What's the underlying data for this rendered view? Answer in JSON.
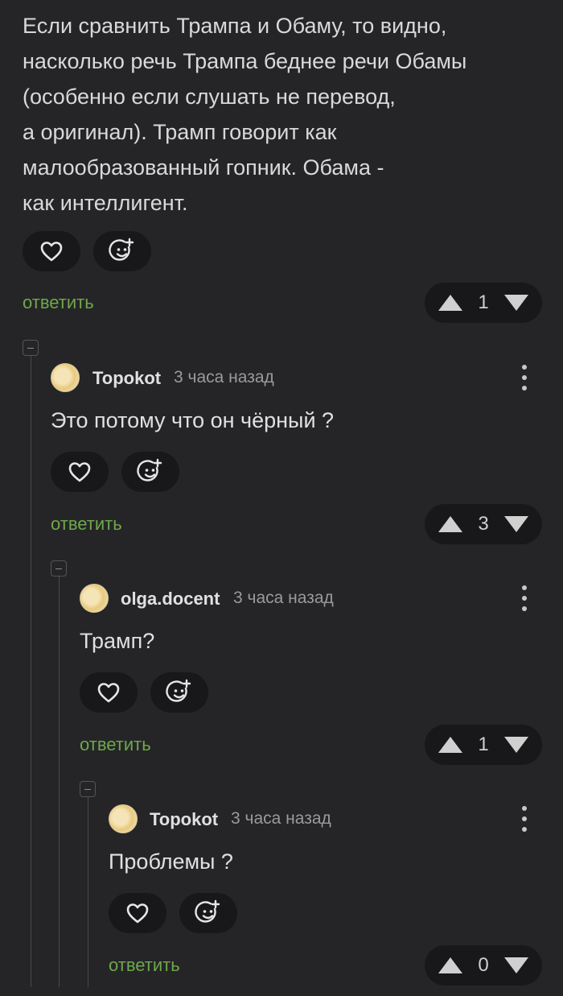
{
  "root": {
    "text": "Если сравнить Трампа и Обаму, то видно,\nнасколько речь Трампа беднее речи Обамы\n(особенно если слушать не перевод,\nа оригинал). Трамп говорит как\nмалообразованный гопник. Обама -\nкак интеллигент.",
    "reply_label": "ответить",
    "votes": "1"
  },
  "comments": [
    {
      "author": "Topokot",
      "time": "3 часа назад",
      "text": "Это потому что он чёрный ?",
      "reply_label": "ответить",
      "votes": "3"
    },
    {
      "author": "olga.docent",
      "time": "3 часа назад",
      "text": "Трамп?",
      "reply_label": "ответить",
      "votes": "1"
    },
    {
      "author": "Topokot",
      "time": "3 часа назад",
      "text": "Проблемы ?",
      "reply_label": "ответить",
      "votes": "0"
    }
  ],
  "icons": {
    "like": "heart-icon",
    "react": "emoji-add-icon",
    "upvote": "triangle-up-icon",
    "downvote": "triangle-down-icon",
    "menu": "vertical-dots-icon",
    "collapse": "minus-square-icon"
  },
  "colors": {
    "background": "#252528",
    "pill": "#18181a",
    "reply": "#6ea84a"
  }
}
